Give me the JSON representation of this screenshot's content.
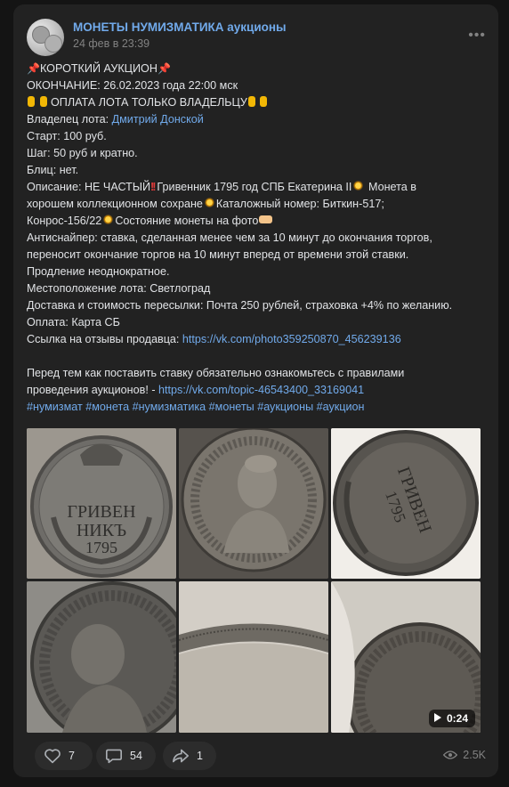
{
  "post": {
    "author": "МОНЕТЫ НУМИЗМАТИКА аукционы",
    "date": "24 фев в 23:39",
    "more": "•••"
  },
  "body": {
    "l1": "КОРОТКИЙ АУКЦИОН",
    "l2": "ОКОНЧАНИЕ: 26.02.2023 года 22:00 мск",
    "l3": "ОПЛАТА ЛОТА ТОЛЬКО ВЛАДЕЛЬЦУ",
    "l4_label": "Владелец лота: ",
    "l4_link": "Дмитрий Донской",
    "l5": "Старт: 100 руб.",
    "l6": "Шаг: 50 руб и кратно.",
    "l7": "Блиц: нет.",
    "l8a": "Описание: НЕ ЧАСТЫЙ",
    "l8b": "Гривенник 1795 год СПБ Екатерина II",
    "l8c": "Монета в",
    "l9a": "хорошем коллекционном сохране",
    "l9b": "Каталожный номер: Биткин-517;",
    "l10a": "Конрос-156/22",
    "l10b": "Состояние монеты на фото",
    "l11": "Антиснайпер: ставка, сделанная менее чем за 10 минут до окончания торгов,",
    "l12": "переносит окончание торгов на 10 минут вперед от времени этой ставки.",
    "l13": "Продление неоднократное.",
    "l14": "Местоположение лота: Светлоград",
    "l15": "Доставка и стоимость пересылки: Почта 250 рублей, страховка +4% по желанию.",
    "l16": "Оплата: Карта СБ",
    "l17_label": "Ссылка на отзывы продавца: ",
    "l17_link": "https://vk.com/photo359250870_456239136",
    "l18": "Перед тем как поставить ставку обязательно ознакомьтесь с правилами",
    "l19_label": "проведения аукционов! - ",
    "l19_link": "https://vk.com/topic-46543400_33169041",
    "hashtags": [
      "#нумизмат",
      "#монета",
      "#нумизматика",
      "#монеты",
      "#аукционы",
      "#аукцион"
    ]
  },
  "coin_text": {
    "t1_line1": "ГРИВЕН",
    "t1_line2": "НИКЪ",
    "t1_line3": "1795",
    "t3_line1": "ГРИВЕН",
    "t3_line2": "1795",
    "video_duration": "0:24"
  },
  "actions": {
    "likes": "7",
    "comments": "54",
    "shares": "1",
    "views": "2.5K"
  },
  "colors": {
    "background": "#141414",
    "card": "#222222",
    "link": "#71aaeb",
    "text": "#e1e3e6",
    "muted": "#828282"
  }
}
